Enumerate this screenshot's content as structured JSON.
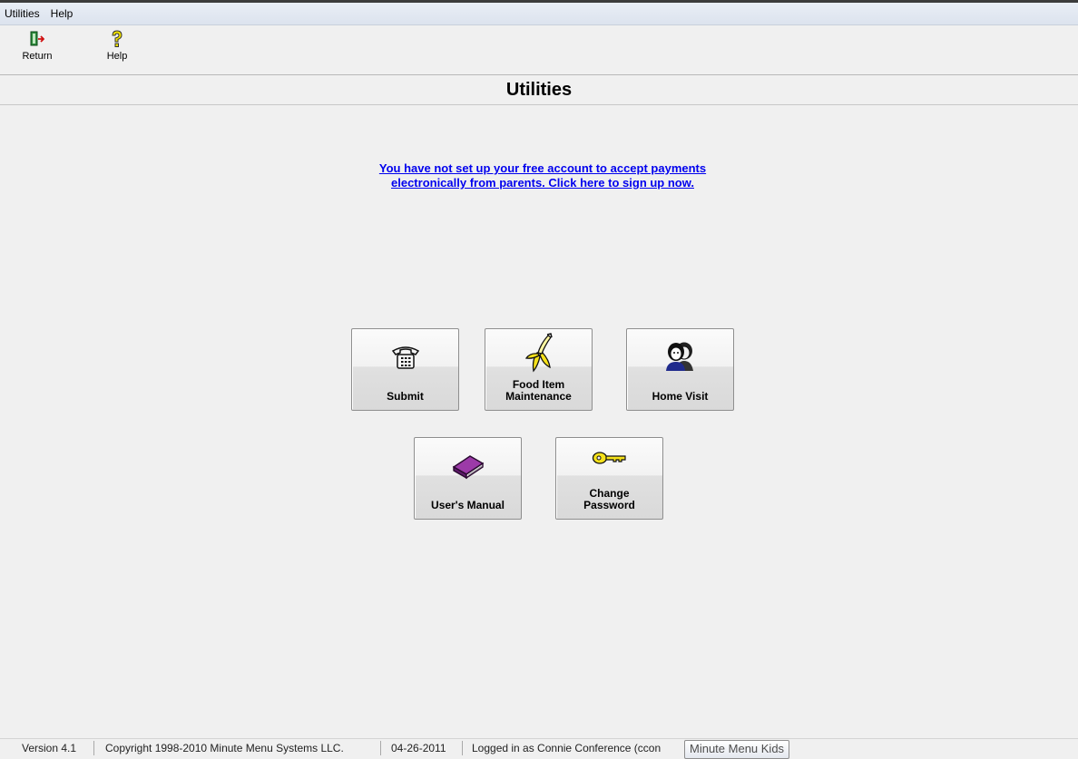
{
  "menubar": {
    "items": [
      "Utilities",
      "Help"
    ]
  },
  "toolbar": {
    "return_label": "Return",
    "help_label": "Help",
    "return_icon": "exit-door-icon",
    "help_icon": "question-mark-icon"
  },
  "page_title": "Utilities",
  "signup_link": {
    "line1": "You have not set up your free account to accept payments",
    "line2": "electronically from parents. Click here to sign up now."
  },
  "tiles": {
    "submit": {
      "label": "Submit",
      "icon": "telephone-icon"
    },
    "food_item_maintenance": {
      "label": "Food Item\nMaintenance",
      "icon": "banana-icon"
    },
    "home_visit": {
      "label": "Home Visit",
      "icon": "people-icon"
    },
    "users_manual": {
      "label": "User's Manual",
      "icon": "book-icon"
    },
    "change_password": {
      "label": "Change\nPassword",
      "icon": "key-icon"
    }
  },
  "statusbar": {
    "version": "Version 4.1",
    "copyright": "Copyright 1998-2010 Minute Menu Systems LLC.",
    "date": "04-26-2011",
    "login": "Logged in as Connie Conference (ccon"
  },
  "tooltip": "Minute Menu Kids",
  "colors": {
    "link": "#0000ee",
    "background": "#f0f0f0"
  }
}
